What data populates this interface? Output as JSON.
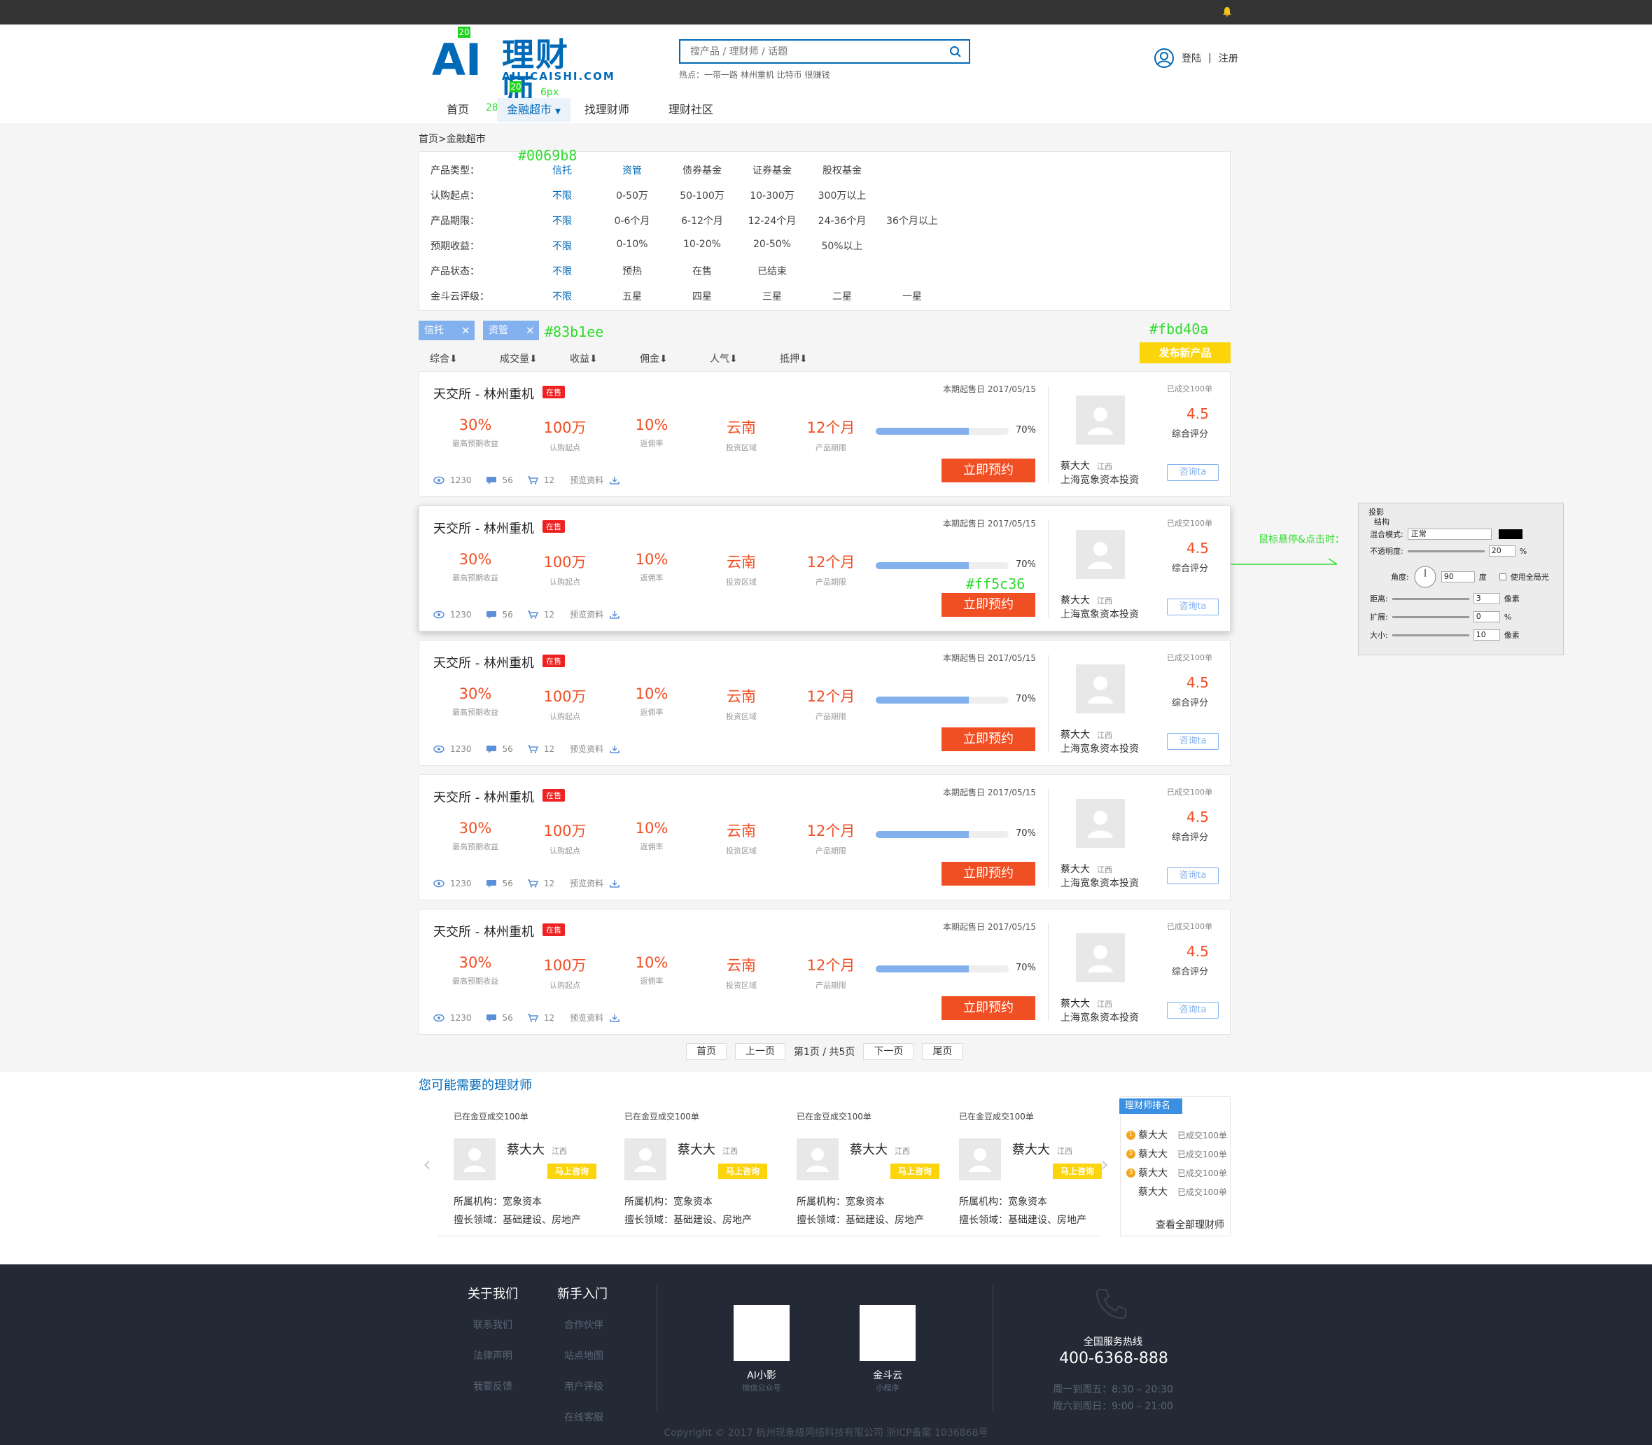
{
  "header": {
    "logo_ai": "AI",
    "logo_cn": "理财师",
    "logo_en": "AILICAISHI.COM",
    "search_placeholder": "搜产品 / 理财师 / 话题",
    "hot_prefix": "热点：",
    "hot_terms": "一带一路 林州重机 比特币 很赚钱",
    "login": "登陆",
    "sep": "|",
    "register": "注册"
  },
  "nav": [
    "首页",
    "金融超市",
    "找理财师",
    "理财社区"
  ],
  "breadcrumb": "首页>金融超市",
  "filters": [
    {
      "label": "产品类型：",
      "options": [
        "信托",
        "资管",
        "债券基金",
        "证券基金",
        "股权基金"
      ]
    },
    {
      "label": "认购起点：",
      "options": [
        "不限",
        "0-50万",
        "50-100万",
        "10-300万",
        "300万以上"
      ]
    },
    {
      "label": "产品期限：",
      "options": [
        "不限",
        "0-6个月",
        "6-12个月",
        "12-24个月",
        "24-36个月",
        "36个月以上"
      ]
    },
    {
      "label": "预期收益：",
      "options": [
        "不限",
        "0-10%",
        "10-20%",
        "20-50%",
        "50%以上"
      ]
    },
    {
      "label": "产品状态：",
      "options": [
        "不限",
        "预热",
        "在售",
        "已结束"
      ]
    },
    {
      "label": "金斗云评级：",
      "options": [
        "不限",
        "五星",
        "四星",
        "三星",
        "二星",
        "一星"
      ]
    }
  ],
  "tags": [
    "信托",
    "资管"
  ],
  "tag_close": "×",
  "publish": "发布新产品",
  "sorts": [
    "综合⬇",
    "成交量⬇",
    "收益⬇",
    "佣金⬇",
    "人气⬇",
    "抵押⬇"
  ],
  "product": {
    "title": "天交所 - 林州重机",
    "badge": "在售",
    "date": "本期起售日 2017/05/15",
    "metrics": [
      {
        "value": "30%",
        "label": "最高预期收益"
      },
      {
        "value": "100万",
        "label": "认购起点"
      },
      {
        "value": "10%",
        "label": "返佣率"
      },
      {
        "value": "云南",
        "label": "投资区域"
      },
      {
        "value": "12个月",
        "label": "产品期限"
      }
    ],
    "progress": 70,
    "progress_label": "70%",
    "views": "1230",
    "comments": "56",
    "carts": "12",
    "preview": "预览资料",
    "reserve": "立即预约",
    "advisor": "蔡大大",
    "region": "江西",
    "org": "上海宽象资本投资",
    "sold": "已成交100单",
    "score": "4.5",
    "score_label": "综合评分",
    "consult": "咨询ta"
  },
  "annotations": {
    "blue": "#0069b8",
    "tag_color": "#83b1ee",
    "publish_color": "#fbd40a",
    "reserve_color": "#ff5c36",
    "hover_note": "鼠标悬停&点击时：",
    "n20a": "20",
    "n20b": "20",
    "px6a": "6px",
    "px6b": "6px",
    "px28": "28px"
  },
  "ps_panel": {
    "title": "投影",
    "sub": "结构",
    "blend_label": "混合模式:",
    "blend": "正常",
    "opacity_label": "不透明度:",
    "opacity": "20",
    "angle_label": "角度:",
    "angle": "90",
    "deg": "度",
    "global": "使用全局光",
    "dist_label": "距离:",
    "dist": "3",
    "spread_label": "扩展:",
    "spread": "0",
    "size_label": "大小:",
    "size": "10",
    "px": "像素",
    "pct": "%"
  },
  "pager": [
    "首页",
    "上一页",
    "第1页 / 共5页",
    "下一页",
    "尾页"
  ],
  "advisors_title": "您可能需要的理财师",
  "advisor_card": {
    "sold": "已在金豆成交100单",
    "name": "蔡大大",
    "region": "江西",
    "btn": "马上咨询",
    "org": "所属机构：宽象资本",
    "field": "擅长领域：基础建设、房地产"
  },
  "ranking": {
    "title": "理财师排名",
    "items": [
      {
        "num": "1",
        "name": "蔡大大",
        "sold": "已成交100单"
      },
      {
        "num": "2",
        "name": "蔡大大",
        "sold": "已成交100单"
      },
      {
        "num": "3",
        "name": "蔡大大",
        "sold": "已成交100单"
      },
      {
        "num": "",
        "name": "蔡大大",
        "sold": "已成交100单"
      }
    ],
    "all": "查看全部理财师"
  },
  "footer": {
    "about": "关于我们",
    "about_items": [
      "联系我们",
      "法律声明",
      "我要反馈"
    ],
    "newbie": "新手入门",
    "newbie_items": [
      "合作伙伴",
      "站点地图",
      "用户评级",
      "在线客服"
    ],
    "qr1_name": "AI小影",
    "qr1_sub": "微信公众号",
    "qr2_name": "金斗云",
    "qr2_sub": "小程序",
    "hotline_label": "全国服务热线",
    "hotline": "400-6368-888",
    "hours1": "周一到周五：8:30 – 20:30",
    "hours2": "周六到周日：9:00 – 21:00",
    "copyright": "Copyright © 2017 杭州现象级网络科技有限公司 浙ICP备案 1036868号"
  },
  "colors": {
    "brand": "#0069b8",
    "tag": "#83b1ee",
    "publish": "#fbd40a",
    "reserve": "#f04e23",
    "footer": "#232a36"
  }
}
